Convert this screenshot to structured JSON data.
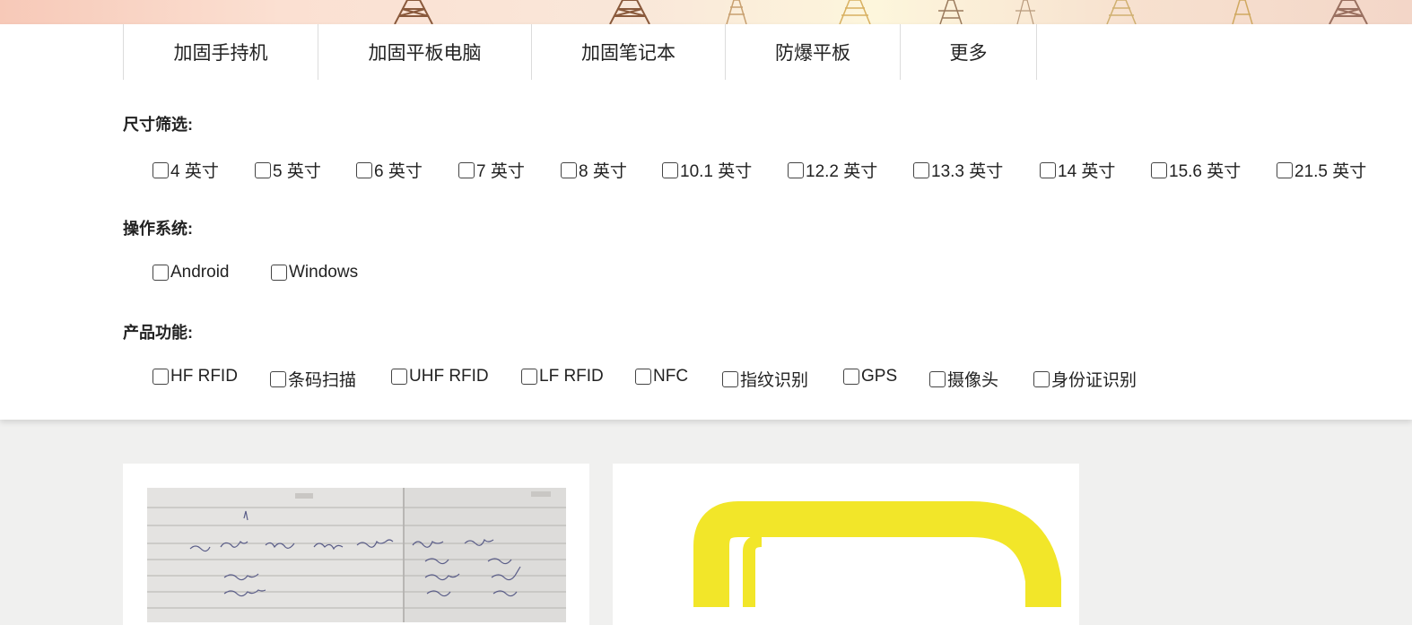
{
  "nav": {
    "tabs": [
      {
        "label": "加固手持机"
      },
      {
        "label": "加固平板电脑"
      },
      {
        "label": "加固笔记本"
      },
      {
        "label": "防爆平板"
      },
      {
        "label": "更多"
      }
    ]
  },
  "filters": {
    "size": {
      "title": "尺寸筛选:",
      "options": [
        "4 英寸",
        "5 英寸",
        "6 英寸",
        "7 英寸",
        "8 英寸",
        "10.1 英寸",
        "12.2 英寸",
        "13.3 英寸",
        "14 英寸",
        "15.6 英寸",
        "21.5 英寸"
      ]
    },
    "os": {
      "title": "操作系统:",
      "options": [
        "Android",
        "Windows"
      ]
    },
    "features": {
      "title": "产品功能:",
      "options": [
        "HF RFID",
        "条码扫描",
        "UHF RFID",
        "LF RFID",
        "NFC",
        "指纹识别",
        "GPS",
        "摄像头",
        "身份证识别"
      ]
    }
  },
  "products": [
    {
      "image": "handwritten-notebook-photo"
    },
    {
      "image": "yellow-logo-graphic"
    }
  ],
  "colors": {
    "logo_yellow": "#f2e629",
    "panel_bg": "#ffffff",
    "page_bg": "#f0f0ef"
  }
}
